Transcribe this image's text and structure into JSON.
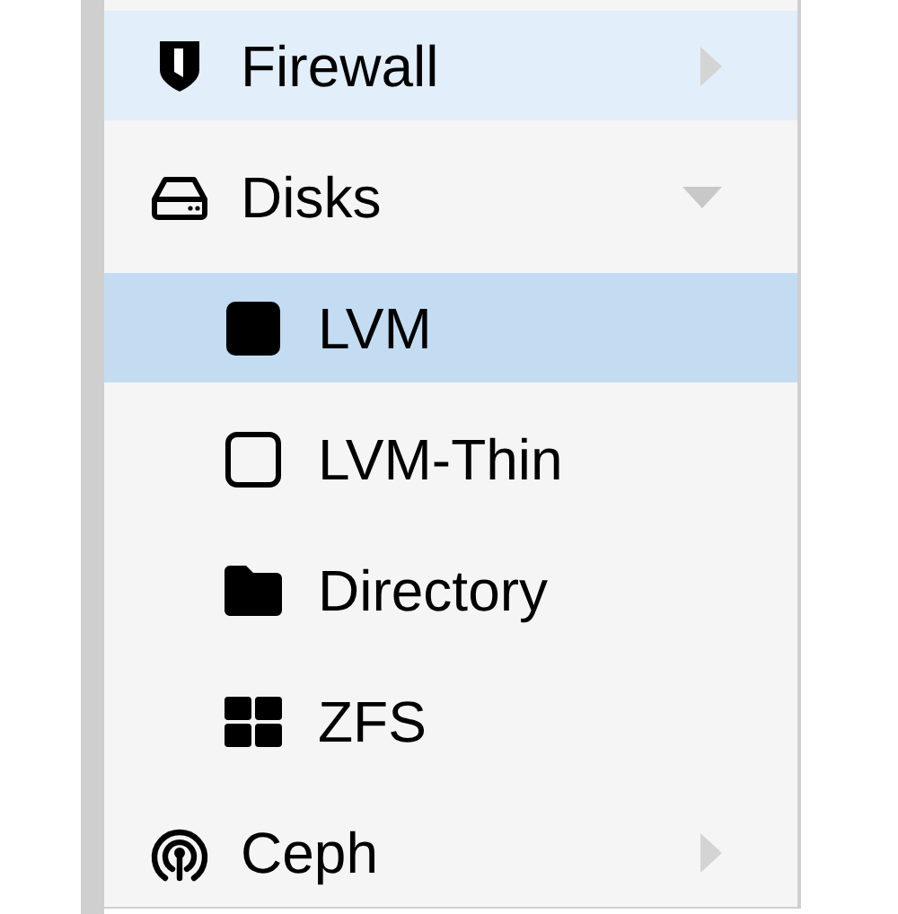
{
  "nav": {
    "items": [
      {
        "label": "Firewall",
        "selected": false,
        "hovered": true,
        "expanded": false
      },
      {
        "label": "Disks",
        "selected": false,
        "hovered": false,
        "expanded": true,
        "children": [
          {
            "label": "LVM",
            "selected": true,
            "hovered": false
          },
          {
            "label": "LVM-Thin",
            "selected": false,
            "hovered": false
          },
          {
            "label": "Directory",
            "selected": false,
            "hovered": false
          },
          {
            "label": "ZFS",
            "selected": false,
            "hovered": false
          }
        ]
      },
      {
        "label": "Ceph",
        "selected": false,
        "hovered": false,
        "expanded": false
      }
    ]
  }
}
